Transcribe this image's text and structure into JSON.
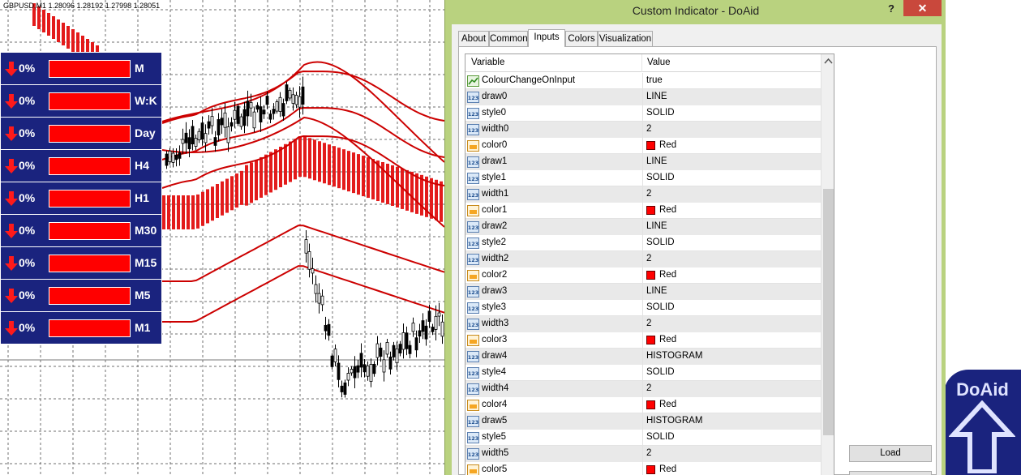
{
  "chart": {
    "header_text": "GBPUSD,M1  1.28096 1.28192 1.27998 1.28051",
    "colors": {
      "band": "#cc0000",
      "histogram": "#e31b1b",
      "candle": "#000000",
      "grid": "#6f6f6f",
      "panel": "#1a237e"
    }
  },
  "timeframes": [
    {
      "pct": "0%",
      "label": "M"
    },
    {
      "pct": "0%",
      "label": "W:K"
    },
    {
      "pct": "0%",
      "label": "Day"
    },
    {
      "pct": "0%",
      "label": "H4"
    },
    {
      "pct": "0%",
      "label": "H1"
    },
    {
      "pct": "0%",
      "label": "M30"
    },
    {
      "pct": "0%",
      "label": "M15"
    },
    {
      "pct": "0%",
      "label": "M5"
    },
    {
      "pct": "0%",
      "label": "M1"
    }
  ],
  "dialog": {
    "title": "Custom Indicator - DoAid",
    "help": "?",
    "close": "✕",
    "tabs": [
      "About",
      "Common",
      "Inputs",
      "Colors",
      "Visualization"
    ],
    "active_tab": "Inputs",
    "grid": {
      "col_variable": "Variable",
      "col_value": "Value",
      "rows": [
        {
          "icon": "bool",
          "name": "ColourChangeOnInput",
          "value": "true"
        },
        {
          "icon": "int",
          "name": "draw0",
          "value": "LINE"
        },
        {
          "icon": "int",
          "name": "style0",
          "value": "SOLID"
        },
        {
          "icon": "int",
          "name": "width0",
          "value": "2"
        },
        {
          "icon": "color",
          "name": "color0",
          "value": "Red"
        },
        {
          "icon": "int",
          "name": "draw1",
          "value": "LINE"
        },
        {
          "icon": "int",
          "name": "style1",
          "value": "SOLID"
        },
        {
          "icon": "int",
          "name": "width1",
          "value": "2"
        },
        {
          "icon": "color",
          "name": "color1",
          "value": "Red"
        },
        {
          "icon": "int",
          "name": "draw2",
          "value": "LINE"
        },
        {
          "icon": "int",
          "name": "style2",
          "value": "SOLID"
        },
        {
          "icon": "int",
          "name": "width2",
          "value": "2"
        },
        {
          "icon": "color",
          "name": "color2",
          "value": "Red"
        },
        {
          "icon": "int",
          "name": "draw3",
          "value": "LINE"
        },
        {
          "icon": "int",
          "name": "style3",
          "value": "SOLID"
        },
        {
          "icon": "int",
          "name": "width3",
          "value": "2"
        },
        {
          "icon": "color",
          "name": "color3",
          "value": "Red"
        },
        {
          "icon": "int",
          "name": "draw4",
          "value": "HISTOGRAM"
        },
        {
          "icon": "int",
          "name": "style4",
          "value": "SOLID"
        },
        {
          "icon": "int",
          "name": "width4",
          "value": "2"
        },
        {
          "icon": "color",
          "name": "color4",
          "value": "Red"
        },
        {
          "icon": "int",
          "name": "draw5",
          "value": "HISTOGRAM"
        },
        {
          "icon": "int",
          "name": "style5",
          "value": "SOLID"
        },
        {
          "icon": "int",
          "name": "width5",
          "value": "2"
        },
        {
          "icon": "color",
          "name": "color5",
          "value": "Red"
        }
      ]
    },
    "load_button": "Load"
  },
  "logo": {
    "text": "DoAid"
  }
}
